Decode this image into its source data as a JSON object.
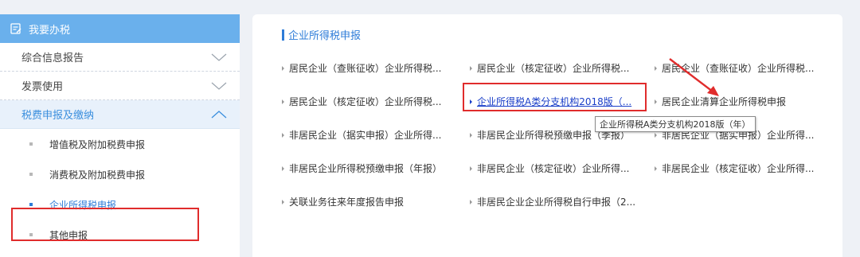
{
  "sidebar": {
    "header": {
      "title": "我要办税",
      "icon": "form-icon"
    },
    "menu": [
      {
        "label": "综合信息报告",
        "state": "collapsed"
      },
      {
        "label": "发票使用",
        "state": "collapsed"
      },
      {
        "label": "税费申报及缴纳",
        "state": "expanded"
      }
    ],
    "submenu": [
      {
        "label": "增值税及附加税费申报"
      },
      {
        "label": "消费税及附加税费申报"
      },
      {
        "label": "企业所得税申报",
        "selected": true
      },
      {
        "label": "其他申报"
      }
    ]
  },
  "main": {
    "title": "企业所得税申报",
    "links": [
      "居民企业（查账征收）企业所得税...",
      "居民企业（核定征收）企业所得税...",
      "居民企业（查账征收）企业所得税...",
      "居民企业（核定征收）企业所得税...",
      "企业所得税A类分支机构2018版（...",
      "居民企业清算企业所得税申报",
      "非居民企业（据实申报）企业所得...",
      "非居民企业所得税预缴申报（季报）",
      "非居民企业（据实申报）企业所得...",
      "非居民企业所得税预缴申报（年报）",
      "非居民企业（核定征收）企业所得...",
      "非居民企业（核定征收）企业所得...",
      "关联业务往来年度报告申报",
      "非居民企业企业所得税自行申报（2..."
    ],
    "tooltip": "企业所得税A类分支机构2018版（年）"
  },
  "colors": {
    "accent": "#2e7cd8",
    "header": "#6ab0ec",
    "highlight_border": "#e02c2c"
  }
}
